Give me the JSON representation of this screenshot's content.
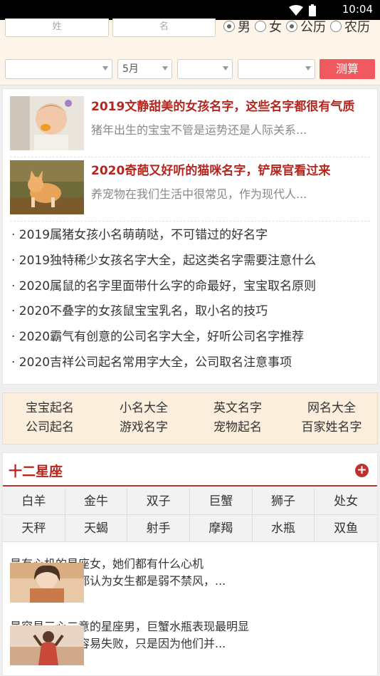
{
  "status_bar": {
    "time": "10:04"
  },
  "form": {
    "surname_placeholder": "姓",
    "name_placeholder": "名",
    "gender_options": [
      "男",
      "女"
    ],
    "calendar_options": [
      "公历",
      "农历"
    ],
    "selects": [
      "",
      "5月",
      "",
      ""
    ],
    "submit_label": "测算"
  },
  "articles": [
    {
      "title": "2019文静甜美的女孩名字，这些名字都很有气质",
      "desc": "猪年出生的宝宝不管是运势还是人际关系..."
    },
    {
      "title": "2020奇葩又好听的猫咪名字，铲屎官看过来",
      "desc": "养宠物在我们生活中很常见，作为现代人..."
    }
  ],
  "links": [
    "· 2019属猪女孩小名萌萌哒，不可错过的好名字",
    "· 2019独特稀少女孩名字大全，起这类名字需要注意什么",
    "· 2020属鼠的名字里面带什么字的命最好，宝宝取名原则",
    "· 2020不叠字的女孩鼠宝宝乳名，取小名的技巧",
    "· 2020霸气有创意的公司名字大全，好听公司名字推荐",
    "· 2020吉祥公司起名常用字大全，公司取名注意事项"
  ],
  "categories": [
    "宝宝起名",
    "小名大全",
    "英文名字",
    "网名大全",
    "公司起名",
    "游戏名字",
    "宠物起名",
    "百家姓名字"
  ],
  "zodiac": {
    "title": "十二星座",
    "signs": [
      "白羊",
      "金牛",
      "双子",
      "巨蟹",
      "狮子",
      "处女",
      "天秤",
      "天蝎",
      "射手",
      "摩羯",
      "水瓶",
      "双鱼"
    ],
    "articles": [
      {
        "title": "最有心机的星座女，她们都有什么心机",
        "desc": "大多数人心里都认为女生都是弱不禁风，..."
      },
      {
        "title": "最容易三心二意的星座男，巨蟹水瓶表现最明显",
        "desc": "其实有些人最容易失败，只是因为他们并..."
      }
    ]
  },
  "colors": {
    "accent": "#b5261f",
    "button": "#f05a5f"
  }
}
